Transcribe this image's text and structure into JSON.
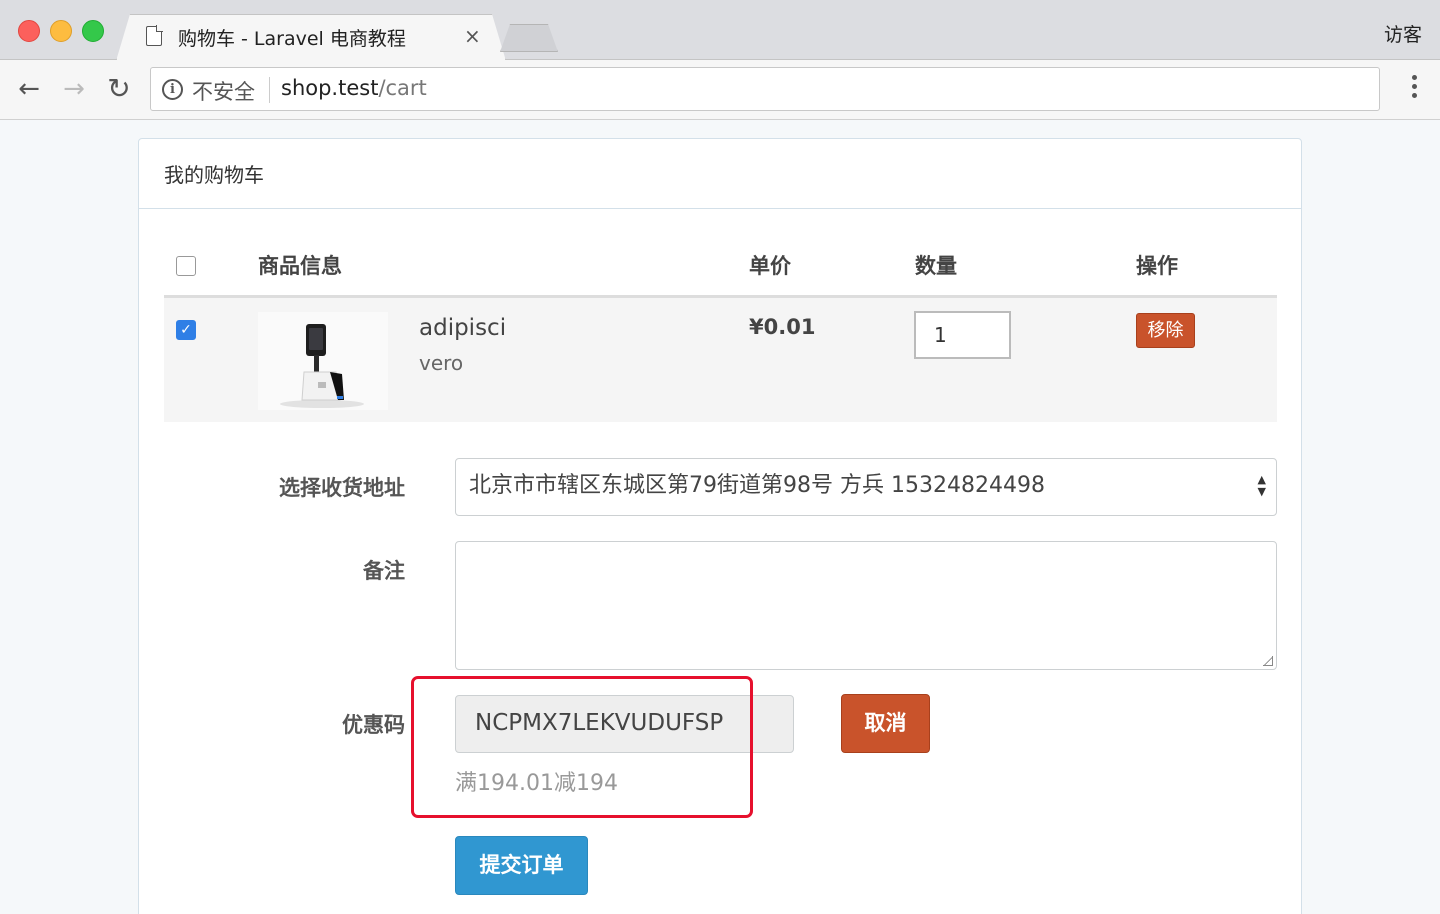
{
  "browser": {
    "tab_title": "购物车 - Laravel 电商教程",
    "tab_close": "×",
    "profile": "访客",
    "security_label": "不安全",
    "url_host": "shop.test",
    "url_path": "/cart",
    "icons": {
      "back": "arrow-left-icon",
      "forward": "arrow-right-icon",
      "reload": "reload-icon",
      "info": "info-icon",
      "menu": "kebab-menu-icon",
      "tab": "document-icon"
    }
  },
  "page": {
    "panel_title": "我的购物车",
    "table": {
      "headers": [
        "商品信息",
        "单价",
        "数量",
        "操作"
      ],
      "select_all_checked": false,
      "rows": [
        {
          "checked": true,
          "image": "product-thumbnail",
          "name": "adipisci",
          "sku": "vero",
          "price": "¥0.01",
          "quantity": "1",
          "action": "移除"
        }
      ]
    },
    "form": {
      "address_label": "选择收货地址",
      "address_value": "北京市市辖区东城区第79街道第98号 方兵 15324824498",
      "remark_label": "备注",
      "remark_value": "",
      "coupon_label": "优惠码",
      "coupon_value": "NCPMX7LEKVUDUFSP",
      "coupon_description": "满194.01减194",
      "cancel_button": "取消",
      "submit_button": "提交订单"
    }
  },
  "colors": {
    "primary_button": "#3097d1",
    "danger_button": "#c9532b",
    "highlight_box": "#e6102d",
    "checkbox_checked": "#2f7fe6"
  }
}
